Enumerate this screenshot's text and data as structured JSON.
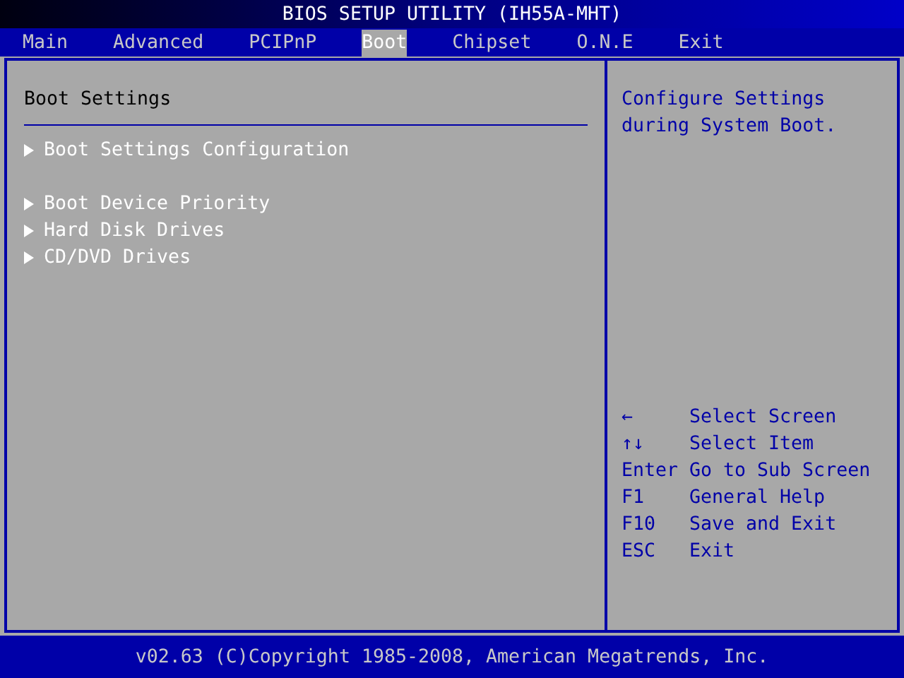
{
  "title": "BIOS SETUP UTILITY (IH55A-MHT)",
  "tabs": [
    {
      "label": "Main",
      "selected": false
    },
    {
      "label": "Advanced",
      "selected": false
    },
    {
      "label": "PCIPnP",
      "selected": false
    },
    {
      "label": "Boot",
      "selected": true
    },
    {
      "label": "Chipset",
      "selected": false
    },
    {
      "label": "O.N.E",
      "selected": false
    },
    {
      "label": "Exit",
      "selected": false
    }
  ],
  "section_title": "Boot Settings",
  "item_groups": [
    [
      {
        "label": "Boot Settings Configuration"
      }
    ],
    [
      {
        "label": "Boot Device Priority"
      },
      {
        "label": "Hard Disk Drives"
      },
      {
        "label": "CD/DVD Drives"
      }
    ]
  ],
  "help_text": "Configure Settings during System Boot.",
  "key_help": [
    {
      "key": "←",
      "action": "Select Screen"
    },
    {
      "key": "↑↓",
      "action": "Select Item"
    },
    {
      "key": "Enter",
      "action": "Go to Sub Screen"
    },
    {
      "key": "F1",
      "action": "General Help"
    },
    {
      "key": "F10",
      "action": "Save and Exit"
    },
    {
      "key": "ESC",
      "action": "Exit"
    }
  ],
  "footer": "v02.63 (C)Copyright 1985-2008, American Megatrends, Inc."
}
